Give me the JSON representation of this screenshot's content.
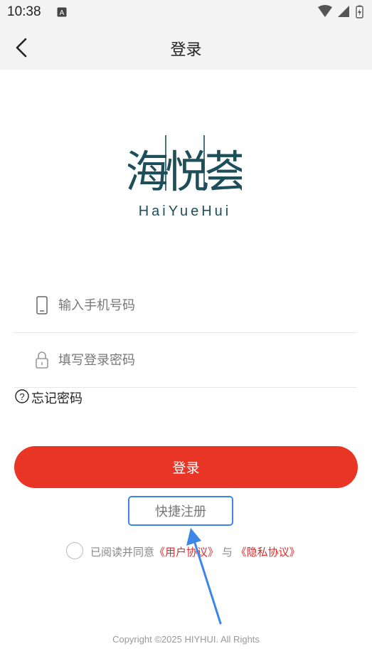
{
  "status_bar": {
    "time": "10:38",
    "a_badge": "A"
  },
  "header": {
    "title": "登录",
    "back_icon": "chevron-left-icon"
  },
  "logo": {
    "chinese": "海悦荟",
    "pinyin": "HaiYueHui"
  },
  "form": {
    "phone": {
      "placeholder": "输入手机号码",
      "value": "",
      "icon": "phone-icon"
    },
    "password": {
      "placeholder": "填写登录密码",
      "value": "",
      "icon": "lock-icon"
    }
  },
  "forgot": {
    "label": "忘记密码",
    "icon": "question-circle-icon"
  },
  "login_button": {
    "label": "登录"
  },
  "register_button": {
    "label": "快捷注册"
  },
  "agreement": {
    "prefix": "已阅读并同意",
    "user_agreement": "《用户协议》",
    "conjunction": "与",
    "privacy_policy": "《隐私协议》"
  },
  "copyright": "Copyright ©2025 HIYHUI. All Rights",
  "colors": {
    "accent_red": "#e93525",
    "link_red": "#e02a2a",
    "highlight_blue": "#3d86e6",
    "logo_teal": "#1d4f5a"
  }
}
